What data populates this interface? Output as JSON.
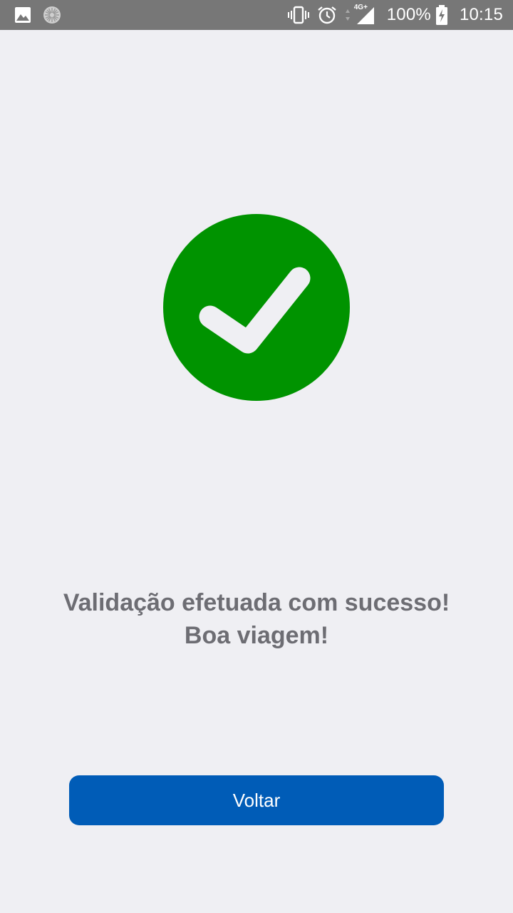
{
  "status_bar": {
    "battery": "100%",
    "time": "10:15",
    "network": "4G+",
    "icons": [
      "image-icon",
      "loading-spinner-icon",
      "vibrate-icon",
      "alarm-icon",
      "data-arrows-icon",
      "signal-icon",
      "battery-charging-icon"
    ]
  },
  "success": {
    "icon": "check-circle-icon",
    "color": "#009300",
    "line1": "Validação efetuada com sucesso!",
    "line2": "Boa viagem!"
  },
  "button": {
    "label": "Voltar",
    "color": "#005cb7"
  }
}
